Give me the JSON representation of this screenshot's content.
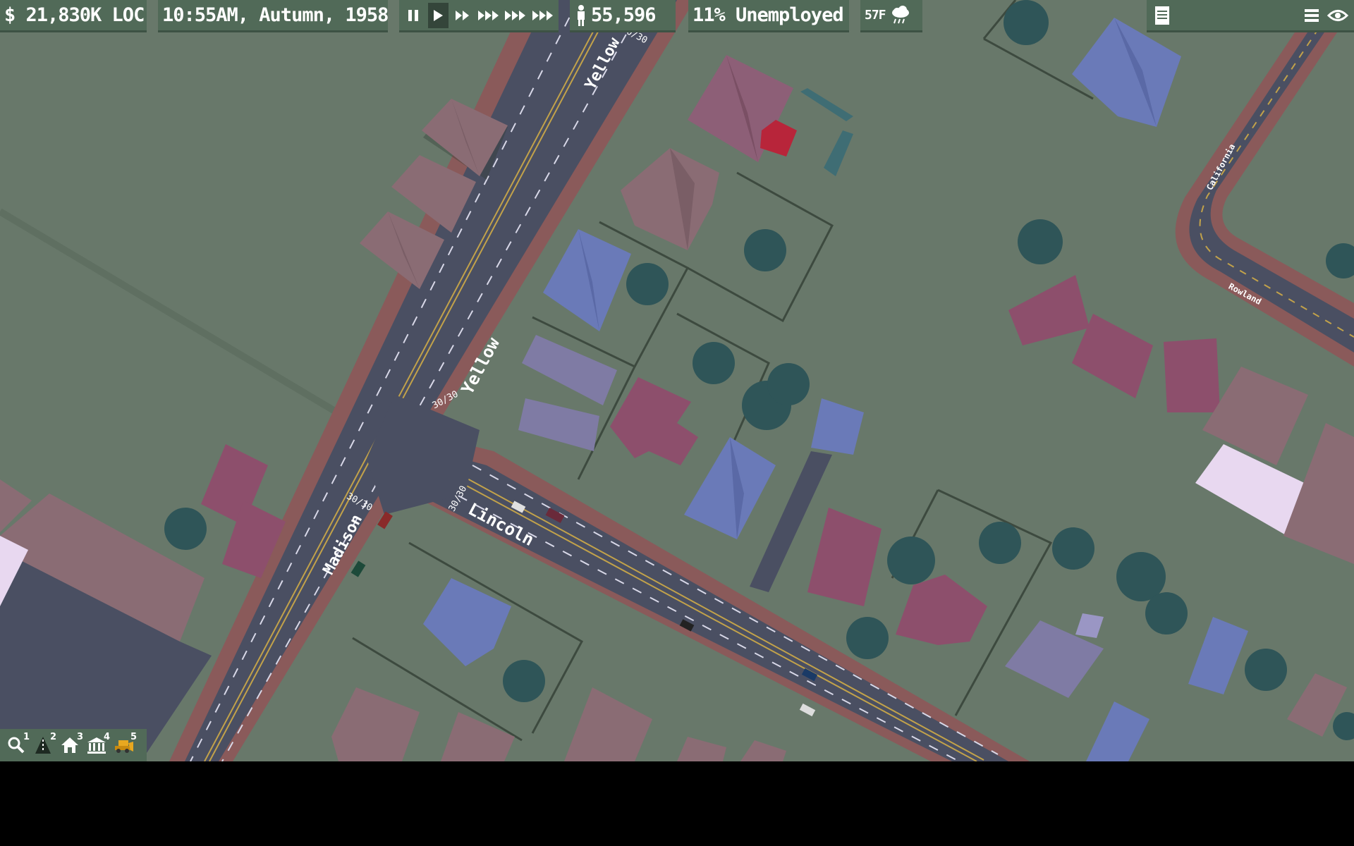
{
  "hud": {
    "money": "$ 21,830K LOC",
    "datetime": "10:55AM, Autumn, 1958",
    "population": "55,596",
    "unemployment": "11% Unemployed",
    "temperature": "57F",
    "weather_icon": "rain-cloud-icon",
    "speed_controls": [
      {
        "name": "pause",
        "icon": "pause-icon",
        "active": false
      },
      {
        "name": "play",
        "icon": "play-icon",
        "active": true
      },
      {
        "name": "speed-2",
        "icon": "fast-forward-icon",
        "active": false
      },
      {
        "name": "speed-3",
        "icon": "faster-forward-icon",
        "active": false
      },
      {
        "name": "speed-4",
        "icon": "very-fast-forward-icon",
        "active": false
      },
      {
        "name": "speed-5",
        "icon": "max-speed-icon",
        "active": false
      }
    ],
    "right_icons": [
      "notes-icon",
      "menu-icon",
      "eye-icon"
    ]
  },
  "streets": {
    "yellow_top": "Yellow",
    "yellow_mid": "Yellow",
    "madison": "Madison",
    "lincoln": "Lincoln",
    "california": "California",
    "rowland": "Rowland",
    "speed_limit": "30/30",
    "speed_limit_b": "30/30",
    "speed_limit_c": "30/30",
    "speed_limit_d": "30/30"
  },
  "toolbar": [
    {
      "icon": "magnifier-icon",
      "num": "1"
    },
    {
      "icon": "road-cone-icon",
      "num": "2"
    },
    {
      "icon": "house-icon",
      "num": "3"
    },
    {
      "icon": "government-building-icon",
      "num": "4"
    },
    {
      "icon": "bulldozer-icon",
      "num": "5"
    }
  ],
  "colors": {
    "grass": "#68786a",
    "road": "#4a4f62",
    "sidewalk": "#8a5a5a",
    "hud": "#516a58",
    "tree": "#2f5558",
    "roof_blue": "#6a7ab8",
    "roof_pink": "#8d4f6c",
    "roof_mauve": "#8a6c74"
  }
}
